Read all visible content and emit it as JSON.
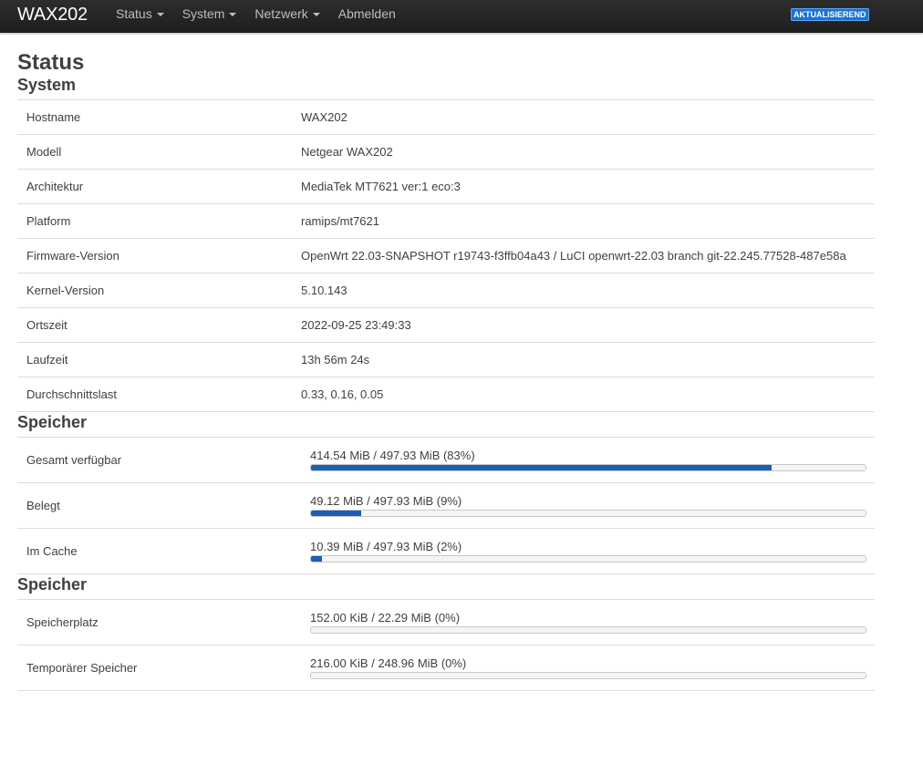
{
  "topbar": {
    "brand": "WAX202",
    "nav": [
      {
        "label": "Status",
        "dropdown": true
      },
      {
        "label": "System",
        "dropdown": true
      },
      {
        "label": "Netzwerk",
        "dropdown": true
      },
      {
        "label": "Abmelden",
        "dropdown": false
      }
    ],
    "badge": "AKTUALISIEREND",
    "badge_color": "#1a73d4"
  },
  "page_title": "Status",
  "system": {
    "title": "System",
    "rows": [
      {
        "key": "Hostname",
        "value": "WAX202"
      },
      {
        "key": "Modell",
        "value": "Netgear WAX202"
      },
      {
        "key": "Architektur",
        "value": "MediaTek MT7621 ver:1 eco:3"
      },
      {
        "key": "Platform",
        "value": "ramips/mt7621"
      },
      {
        "key": "Firmware-Version",
        "value": "OpenWrt 22.03-SNAPSHOT r19743-f3ffb04a43 / LuCI openwrt-22.03 branch git-22.245.77528-487e58a"
      },
      {
        "key": "Kernel-Version",
        "value": "5.10.143"
      },
      {
        "key": "Ortszeit",
        "value": "2022-09-25 23:49:33"
      },
      {
        "key": "Laufzeit",
        "value": "13h 56m 24s"
      },
      {
        "key": "Durchschnittslast",
        "value": "0.33, 0.16, 0.05"
      }
    ]
  },
  "memory": {
    "title": "Speicher",
    "rows": [
      {
        "key": "Gesamt verfügbar",
        "text": "414.54 MiB / 497.93 MiB (83%)",
        "fraction": 0.83
      },
      {
        "key": "Belegt",
        "text": "49.12 MiB / 497.93 MiB (9%)",
        "fraction": 0.09
      },
      {
        "key": "Im Cache",
        "text": "10.39 MiB / 497.93 MiB (2%)",
        "fraction": 0.02
      }
    ]
  },
  "storage": {
    "title": "Speicher",
    "rows": [
      {
        "key": "Speicherplatz",
        "text": "152.00 KiB / 22.29 MiB (0%)",
        "fraction": 0.0
      },
      {
        "key": "Temporärer Speicher",
        "text": "216.00 KiB / 248.96 MiB (0%)",
        "fraction": 0.0
      }
    ]
  },
  "colors": {
    "progress_fill": "#1a5fb4",
    "topbar": "#222222"
  }
}
